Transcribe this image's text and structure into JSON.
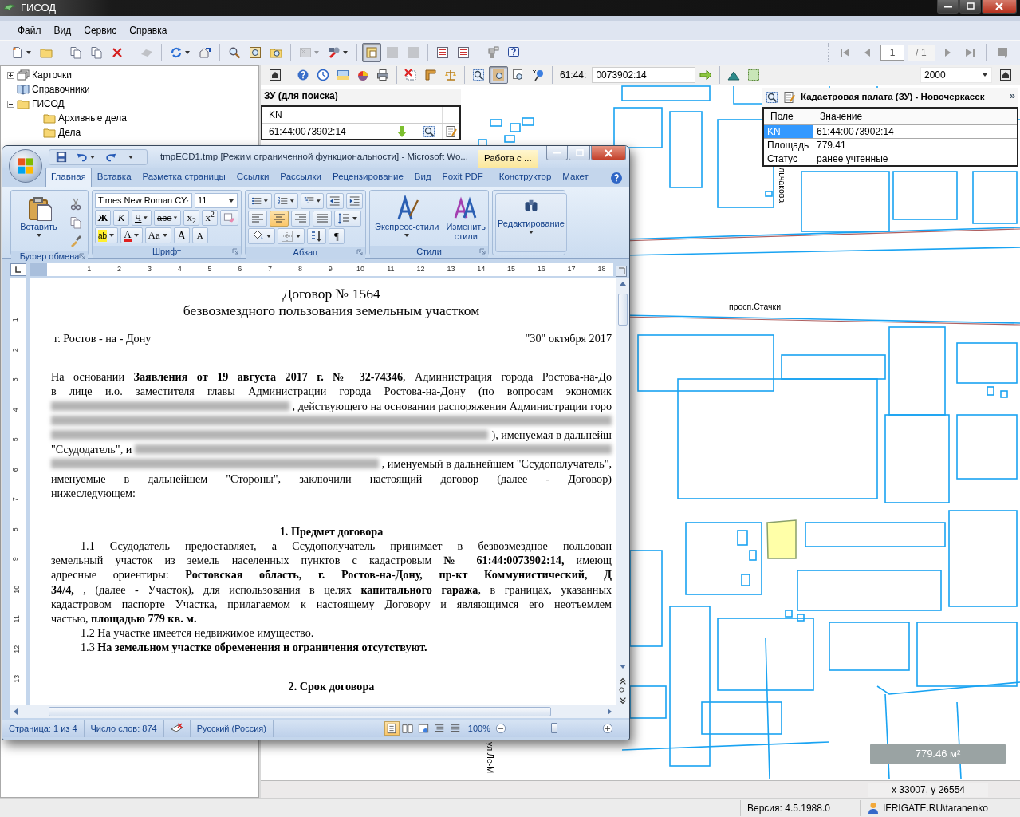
{
  "app": {
    "title": "ГИСОД"
  },
  "menu": [
    "Файл",
    "Вид",
    "Сервис",
    "Справка"
  ],
  "toolbar": {
    "buttons": [
      {
        "selected": false,
        "disabled": false
      },
      {
        "selected": false,
        "disabled": false
      },
      {
        "selected": false,
        "disabled": false
      },
      {
        "selected": false,
        "disabled": false
      },
      {
        "selected": false,
        "disabled": false
      },
      {
        "selected": false,
        "disabled": true
      },
      {
        "selected": false,
        "disabled": false
      },
      {
        "selected": false,
        "disabled": false
      },
      {
        "selected": false,
        "disabled": false
      },
      {
        "selected": false,
        "disabled": false
      },
      {
        "selected": false,
        "disabled": false
      },
      {
        "selected": false,
        "disabled": true
      },
      {
        "selected": false,
        "disabled": false
      },
      {
        "selected": true,
        "disabled": false
      },
      {
        "selected": false,
        "disabled": true
      },
      {
        "selected": false,
        "disabled": true
      },
      {
        "selected": false,
        "disabled": false
      },
      {
        "selected": false,
        "disabled": false
      },
      {
        "selected": false,
        "disabled": false
      },
      {
        "selected": false,
        "disabled": false
      }
    ],
    "pager": {
      "page": "1",
      "total": "/ 1"
    }
  },
  "tree": [
    {
      "label": "Карточки",
      "kind": "cards",
      "expanded": false
    },
    {
      "label": "Справочники",
      "kind": "book"
    },
    {
      "label": "ГИСОД",
      "kind": "folder",
      "expanded": true,
      "children": [
        {
          "label": "Архивные дела",
          "kind": "folder"
        },
        {
          "label": "Дела",
          "kind": "folder"
        }
      ]
    }
  ],
  "map_toolbar": {
    "buttons": [
      {
        "selected": false
      },
      {
        "selected": false
      },
      {
        "selected": false
      },
      {
        "selected": false
      },
      {
        "selected": false
      },
      {
        "selected": false
      },
      {
        "selected": false
      },
      {
        "selected": false
      },
      {
        "selected": false
      },
      {
        "selected": false
      },
      {
        "selected": true
      },
      {
        "selected": false
      },
      {
        "selected": false
      }
    ],
    "prefix": "61:44:",
    "number": "0073902:14",
    "scale": "2000"
  },
  "search_panel": {
    "title": "ЗУ (для поиска)",
    "column": "KN",
    "value": "61:44:0073902:14"
  },
  "info_panel": {
    "title": "Кадастровая палата (ЗУ) - Новочеркасск",
    "more": "»",
    "columns": [
      "Поле",
      "Значение"
    ],
    "rows": [
      {
        "field": "KN",
        "value": "61:44:0073902:14",
        "selected": true
      },
      {
        "field": "Площадь",
        "value": "779.41",
        "selected": false
      },
      {
        "field": "Статус",
        "value": "ранее учтенные",
        "selected": false
      }
    ]
  },
  "map": {
    "labels": [
      {
        "text": "просп.Стачки",
        "kind": "horizontal"
      },
      {
        "text": "льчакова",
        "kind": "vertical"
      },
      {
        "text": "ул.Ле-М",
        "kind": "vertical"
      }
    ],
    "area": "779.46 м²",
    "coords": "x 33007, y 26554"
  },
  "status_bar": {
    "version": "Версия: 4.5.1988.0",
    "user": "IFRIGATE.RU\\taranenko"
  },
  "word": {
    "title": "tmpECD1.tmp [Режим ограниченной функциональности] - Microsoft Wo...",
    "context_tab": "Работа с ...",
    "tabs": [
      {
        "label": "Главная",
        "selected": true
      },
      {
        "label": "Вставка",
        "selected": false
      },
      {
        "label": "Разметка страницы",
        "selected": false
      },
      {
        "label": "Ссылки",
        "selected": false
      },
      {
        "label": "Рассылки",
        "selected": false
      },
      {
        "label": "Рецензирование",
        "selected": false
      },
      {
        "label": "Вид",
        "selected": false
      },
      {
        "label": "Foxit PDF",
        "selected": false
      },
      {
        "label": "Конструктор",
        "selected": false
      },
      {
        "label": "Макет",
        "selected": false
      }
    ],
    "ribbon": {
      "paste": "Вставить",
      "clipboard": "Буфер обмена",
      "font_name": "Times New Roman CY",
      "font_size": "11",
      "font_buttons": [
        "Ж",
        "К",
        "Ч",
        "abe",
        "x$_{2}$",
        "x$^{2}$"
      ],
      "font_buttons2": [
        "ab",
        "A",
        "Aa",
        "A",
        "A"
      ],
      "font": "Шрифт",
      "align_buttons": [
        {
          "selected": false
        },
        {
          "selected": true
        },
        {
          "selected": false
        },
        {
          "selected": false
        }
      ],
      "pilcrow": "¶",
      "paragraph": "Абзац",
      "quick_styles": "Экспресс-стили",
      "change_styles": "Изменить стили",
      "styles": "Стили",
      "editing": "Редактирование"
    },
    "ruler_h": [
      "1",
      "2",
      "3",
      "4",
      "5",
      "6",
      "7",
      "8",
      "9",
      "10",
      "11",
      "12",
      "13",
      "14",
      "15",
      "16",
      "17",
      "18"
    ],
    "ruler_v": [
      "1",
      "2",
      "3",
      "4",
      "5",
      "6",
      "7",
      "8",
      "9",
      "10",
      "11",
      "12",
      "13"
    ],
    "doc": [
      {
        "kind": "title",
        "parts": [
          {
            "kind": "text",
            "text": "Договор № 1564"
          }
        ]
      },
      {
        "kind": "title",
        "parts": [
          {
            "kind": "text",
            "text": "безвозмездного пользования земельным участком"
          }
        ]
      },
      {
        "kind": "blank"
      },
      {
        "kind": "split",
        "parts": [
          {
            "kind": "text",
            "text": "г. Ростов - на - Дону"
          },
          {
            "kind": "text",
            "text": "\"30\" октября 2017"
          }
        ]
      },
      {
        "kind": "blank"
      },
      {
        "kind": "blank"
      },
      {
        "kind": "justify",
        "parts": [
          {
            "kind": "text",
            "text": "На основании **Заявления от 19 августа 2017 г. № 32-74346**,   Администрация города Ростова-на-До"
          }
        ]
      },
      {
        "kind": "justify",
        "parts": [
          {
            "kind": "text",
            "text": "в лице и.о. заместителя главы Администрации города Ростова-на-Дону (по вопросам экономик"
          }
        ]
      },
      {
        "kind": "justify",
        "parts": [
          {
            "kind": "blur"
          },
          {
            "kind": "text",
            "text": ", действующего на основании распоряжения Администрации горо"
          }
        ]
      },
      {
        "kind": "justify",
        "parts": [
          {
            "kind": "blur"
          }
        ]
      },
      {
        "kind": "justify",
        "parts": [
          {
            "kind": "blur"
          },
          {
            "kind": "text",
            "text": "), именуемая в дальнейш"
          }
        ]
      },
      {
        "kind": "justify",
        "parts": [
          {
            "kind": "text",
            "text": "\"Ссудодатель\", и"
          },
          {
            "kind": "blur"
          }
        ]
      },
      {
        "kind": "justify",
        "parts": [
          {
            "kind": "blur"
          },
          {
            "kind": "text",
            "text": ", именуемый в дальнейшем \"Ссудополучатель\","
          }
        ]
      },
      {
        "kind": "justify",
        "parts": [
          {
            "kind": "text",
            "text": "именуемые в дальнейшем \"Стороны\", заключили настоящий договор (далее - Договор)"
          }
        ]
      },
      {
        "kind": "left",
        "parts": [
          {
            "kind": "text",
            "text": "нижеследующем:"
          }
        ]
      },
      {
        "kind": "blank"
      },
      {
        "kind": "blank"
      },
      {
        "kind": "heading",
        "parts": [
          {
            "kind": "text",
            "text": "1. Предмет договора"
          }
        ]
      },
      {
        "kind": "indent-justify",
        "parts": [
          {
            "kind": "text",
            "text": "1.1 Ссудодатель предоставляет, а Ссудополучатель принимает в безвозмездное пользован"
          }
        ]
      },
      {
        "kind": "justify",
        "parts": [
          {
            "kind": "text",
            "text": "земельный участок из земель населенных пунктов с кадастровым **№ 61:44:0073902:14,** имеющ"
          }
        ]
      },
      {
        "kind": "justify",
        "parts": [
          {
            "kind": "text",
            "text": "адресные ориентиры: **Ростовская область, г. Ростов-на-Дону,  пр-кт Коммунистический,  Д**"
          }
        ]
      },
      {
        "kind": "justify",
        "parts": [
          {
            "kind": "text",
            "text": "**34/4,** , (далее - Участок), для использования в целях **капитального гаража**, в границах, указанных"
          }
        ]
      },
      {
        "kind": "justify",
        "parts": [
          {
            "kind": "text",
            "text": "кадастровом паспорте Участка, прилагаемом к настоящему Договору и являющимся его неотъемлем"
          }
        ]
      },
      {
        "kind": "left",
        "parts": [
          {
            "kind": "text",
            "text": "частью, **площадью 779    кв. м.**"
          }
        ]
      },
      {
        "kind": "indent",
        "parts": [
          {
            "kind": "text",
            "text": "1.2 На участке имеется недвижимое имущество."
          }
        ]
      },
      {
        "kind": "indent",
        "parts": [
          {
            "kind": "text",
            "text": "1.3 **На земельном участке обременения и ограничения отсутствуют.**"
          }
        ]
      },
      {
        "kind": "blank"
      },
      {
        "kind": "blank"
      },
      {
        "kind": "heading",
        "parts": [
          {
            "kind": "text",
            "text": "2. Срок договора"
          }
        ]
      }
    ],
    "status": {
      "page": "Страница: 1 из 4",
      "words": "Число слов: 874",
      "lang": "Русский (Россия)",
      "zoom": "100%",
      "views": [
        {
          "selected": true
        },
        {
          "selected": false
        },
        {
          "selected": false
        },
        {
          "selected": false
        },
        {
          "selected": false
        }
      ],
      "zoom_slider": {
        "level": 0.5
      }
    }
  }
}
